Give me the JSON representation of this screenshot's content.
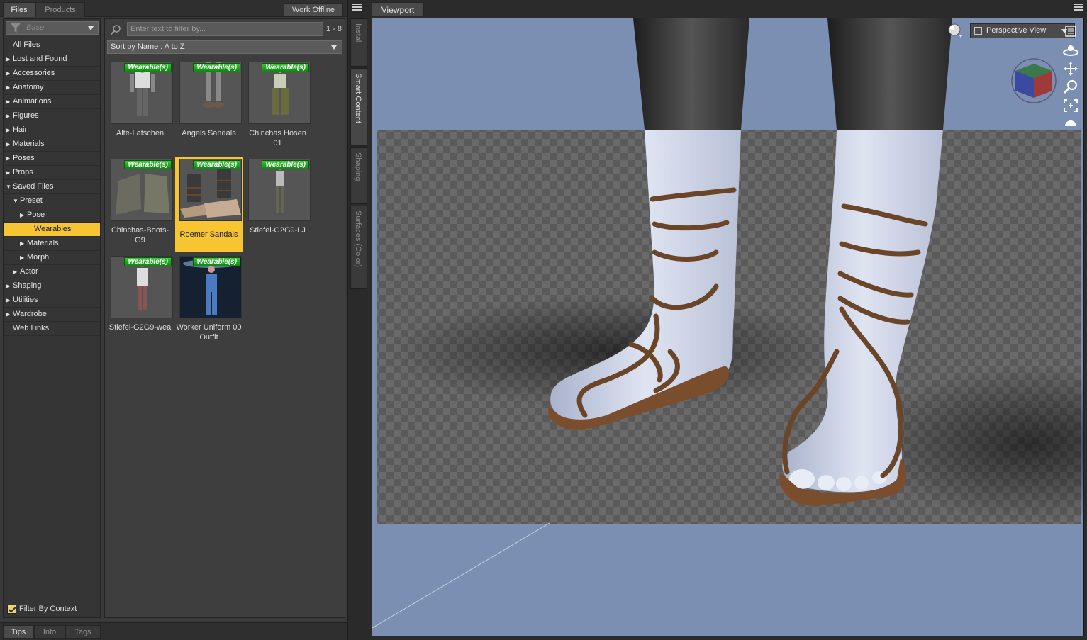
{
  "top_tabs": {
    "files": "Files",
    "products": "Products",
    "work_offline": "Work Offline"
  },
  "category": {
    "base_placeholder": "Base",
    "items": [
      {
        "label": "All Files",
        "arrow": "",
        "depth": 0
      },
      {
        "label": "Lost and Found",
        "arrow": "▶",
        "depth": 0
      },
      {
        "label": "Accessories",
        "arrow": "▶",
        "depth": 0
      },
      {
        "label": "Anatomy",
        "arrow": "▶",
        "depth": 0
      },
      {
        "label": "Animations",
        "arrow": "▶",
        "depth": 0
      },
      {
        "label": "Figures",
        "arrow": "▶",
        "depth": 0
      },
      {
        "label": "Hair",
        "arrow": "▶",
        "depth": 0
      },
      {
        "label": "Materials",
        "arrow": "▶",
        "depth": 0
      },
      {
        "label": "Poses",
        "arrow": "▶",
        "depth": 0
      },
      {
        "label": "Props",
        "arrow": "▶",
        "depth": 0
      },
      {
        "label": "Saved Files",
        "arrow": "▼",
        "depth": 0
      },
      {
        "label": "Preset",
        "arrow": "▼",
        "depth": 1
      },
      {
        "label": "Pose",
        "arrow": "▶",
        "depth": 2
      },
      {
        "label": "Wearables",
        "arrow": "",
        "depth": 2,
        "selected": true
      },
      {
        "label": "Materials",
        "arrow": "▶",
        "depth": 2
      },
      {
        "label": "Morph",
        "arrow": "▶",
        "depth": 2
      },
      {
        "label": "Actor",
        "arrow": "▶",
        "depth": 1
      },
      {
        "label": "Shaping",
        "arrow": "▶",
        "depth": 0
      },
      {
        "label": "Utilities",
        "arrow": "▶",
        "depth": 0
      },
      {
        "label": "Wardrobe",
        "arrow": "▶",
        "depth": 0
      },
      {
        "label": "Web Links",
        "arrow": "",
        "depth": 0
      }
    ],
    "filter_by_context": "Filter By Context"
  },
  "content": {
    "filter_placeholder": "Enter text to filter by...",
    "count": "1 - 8",
    "sort": "Sort by Name : A to Z",
    "badge": "Wearable(s)",
    "tiles": [
      {
        "name": "Alte-Latschen"
      },
      {
        "name": "Angels Sandals"
      },
      {
        "name": "Chinchas Hosen 01"
      },
      {
        "name": "Chinchas-Boots-G9"
      },
      {
        "name": "Roemer Sandals",
        "selected": true
      },
      {
        "name": "Stiefel-G2G9-LJ"
      },
      {
        "name": "Stiefel-G2G9-wea"
      },
      {
        "name": "Worker Uniform 00 Outfit"
      }
    ]
  },
  "bottom_tabs": {
    "tips": "Tips",
    "info": "Info",
    "tags": "Tags"
  },
  "side_tabs": {
    "install": "Install",
    "smart_content": "Smart Content",
    "shaping": "Shaping",
    "surfaces": "Surfaces (Color)"
  },
  "viewport": {
    "tab": "Viewport",
    "view": "Perspective View"
  },
  "colors": {
    "accent": "#f7c531",
    "badge_green": "#1aa51a",
    "viewport_bg": "#7b8fb3"
  }
}
